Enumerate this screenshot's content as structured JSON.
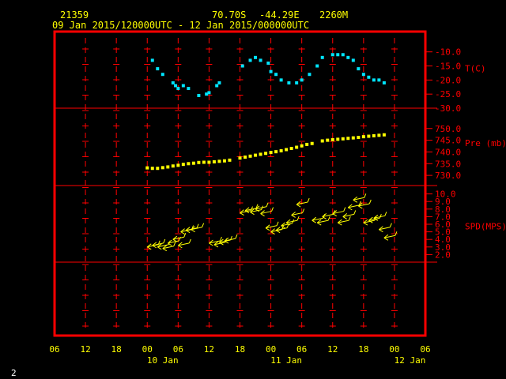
{
  "header": {
    "station": "21359",
    "lat": "70.70S",
    "lon": "-44.29E",
    "elev": "2260M",
    "range": "09 Jan 2015/120000UTC - 12 Jan 2015/000000UTC"
  },
  "footer": {
    "page": "2"
  },
  "colors": {
    "frame": "#ff0000",
    "temp": "#00e5ff",
    "pres": "#ffff00",
    "wind": "#ffff00",
    "label": "#ff0000",
    "text": "#ffff00"
  },
  "chart_data": {
    "type": "scatter",
    "x_axis": {
      "range_hours": [
        -6,
        66
      ],
      "ticks": [
        "06",
        "12",
        "18",
        "00",
        "06",
        "12",
        "18",
        "00",
        "06",
        "12",
        "18",
        "00",
        "06"
      ],
      "day_labels": [
        {
          "label": "10 Jan",
          "hour": 15
        },
        {
          "label": "11 Jan",
          "hour": 39
        },
        {
          "label": "12 Jan",
          "hour": 63
        }
      ]
    },
    "panels": [
      {
        "name": "temp",
        "label": "T(C)",
        "ylim": [
          -30,
          -7
        ],
        "ticks": [
          -10,
          -15,
          -20,
          -25,
          -30
        ],
        "tick_labels": [
          "-10.0",
          "-15.0",
          "-20.0",
          "-25.0",
          "-30.0"
        ],
        "series": [
          {
            "type": "scatter",
            "x": [
              13,
              14,
              15,
              17,
              17.5,
              18,
              19,
              20,
              22,
              23.5,
              24,
              25.5,
              26,
              30.5,
              32,
              33,
              34,
              35.5,
              36,
              37,
              38,
              39.5,
              41,
              42,
              43.5,
              45,
              46,
              48,
              49,
              50,
              51,
              52,
              53,
              54,
              55,
              56,
              57,
              58
            ],
            "y": [
              -13,
              -16,
              -18,
              -21,
              -22,
              -23,
              -22,
              -23,
              -25.5,
              -25,
              -24.5,
              -22,
              -21,
              -15,
              -13,
              -12,
              -13,
              -14,
              -17,
              -18,
              -20,
              -21,
              -21,
              -20,
              -18,
              -15,
              -12,
              -11,
              -11,
              -11,
              -12,
              -13,
              -16,
              -18,
              -19,
              -20,
              -20,
              -21
            ]
          }
        ]
      },
      {
        "name": "pressure",
        "label": "Pre (mb)",
        "ylim": [
          726,
          758
        ],
        "ticks": [
          730,
          735,
          740,
          745,
          750
        ],
        "tick_labels": [
          "730.0",
          "735.0",
          "740.0",
          "745.0",
          "750.0"
        ],
        "series": [
          {
            "type": "scatter",
            "x": [
              12,
              13,
              14,
              15,
              16,
              17,
              18,
              19,
              20,
              21,
              22,
              23,
              24,
              25,
              26,
              27,
              28,
              30,
              31,
              32,
              33,
              34,
              35,
              36,
              37,
              38,
              39,
              40,
              41,
              42,
              43,
              44,
              46,
              47,
              48,
              49,
              50,
              51,
              52,
              53,
              54,
              55,
              56,
              57,
              58
            ],
            "y": [
              733.2,
              733.0,
              733.0,
              733.3,
              733.6,
              734.0,
              734.3,
              734.7,
              735.0,
              735.2,
              735.5,
              735.6,
              735.6,
              735.8,
              736.0,
              736.2,
              736.5,
              737.4,
              737.8,
              738.2,
              738.6,
              739.0,
              739.4,
              739.8,
              740.1,
              740.5,
              741.0,
              741.5,
              742.0,
              742.6,
              743.2,
              743.6,
              744.7,
              745.0,
              745.2,
              745.4,
              745.6,
              745.8,
              746.0,
              746.2,
              746.5,
              746.7,
              746.9,
              747.1,
              747.3
            ]
          }
        ]
      },
      {
        "name": "wind",
        "label": "SPD(MPS)",
        "ylim": [
          1,
          11
        ],
        "ticks": [
          2,
          3,
          4,
          5,
          6,
          7,
          8,
          9,
          10
        ],
        "tick_labels": [
          "2.0",
          "3.0",
          "4.0",
          "5.0",
          "6.0",
          "7.0",
          "8.0",
          "9.0",
          "10.0"
        ],
        "series": [
          {
            "type": "wind_barb",
            "x": [
              12,
              13,
              14,
              15,
              16,
              17,
              18,
              18.5,
              19.5,
              20.5,
              24,
              25,
              26,
              27,
              30,
              31,
              32,
              33,
              34,
              35,
              36,
              37,
              38,
              39,
              40,
              41,
              44,
              45,
              46,
              48,
              49,
              50,
              51,
              52,
              53,
              54,
              55,
              56,
              57,
              58
            ],
            "y": [
              3,
              3.2,
              3,
              2.8,
              3.5,
              4,
              3.2,
              5,
              5.2,
              5.3,
              3.5,
              3.3,
              3.6,
              3.8,
              7.5,
              7.8,
              7.6,
              8,
              7.4,
              5.5,
              5,
              5.2,
              5.8,
              6.2,
              7.2,
              8.6,
              6.5,
              6.2,
              7,
              7.4,
              6.2,
              7,
              8.2,
              9.2,
              8.4,
              6.2,
              6.5,
              6.8,
              5.3,
              4.2
            ]
          }
        ]
      }
    ]
  }
}
